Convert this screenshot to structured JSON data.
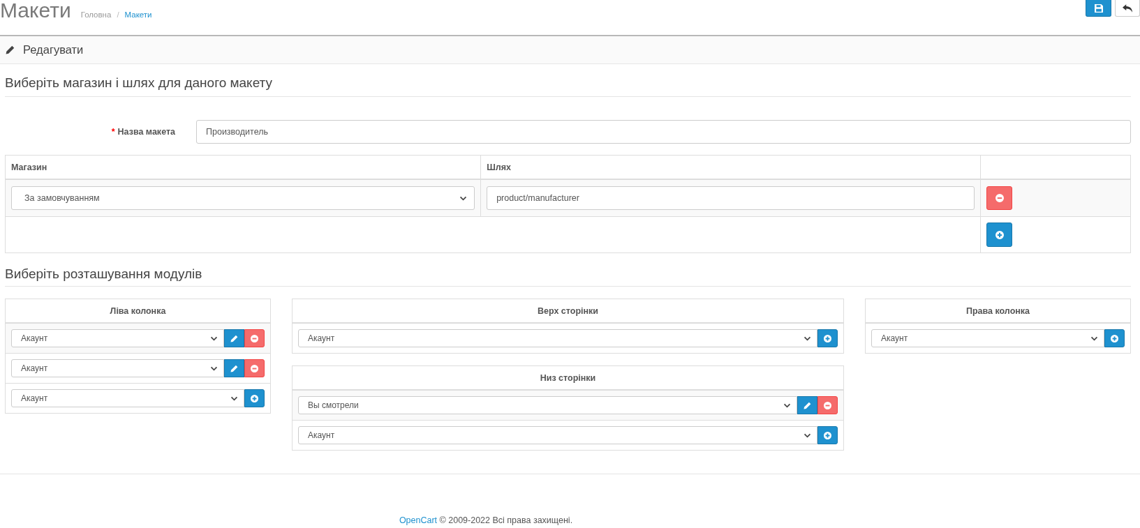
{
  "page_header": {
    "title": "Макети",
    "breadcrumb": {
      "separator": "/",
      "items": [
        {
          "label": "Головна",
          "current": false
        },
        {
          "label": "Макети",
          "current": true
        }
      ]
    },
    "actions": [
      {
        "kind": "save"
      },
      {
        "kind": "back"
      }
    ]
  },
  "panel": {
    "heading": "Редагувати"
  },
  "store_route_section": {
    "legend": "Виберіть магазин і шлях для даного макету",
    "name_field": {
      "label": "Назва макета",
      "required_mark": "*",
      "value": "Производитель"
    },
    "table": {
      "columns": [
        "Магазин",
        "Шлях"
      ],
      "rows": [
        {
          "store": "За замовчуванням",
          "route": "product/manufacturer"
        }
      ]
    }
  },
  "module_section": {
    "legend": "Виберіть розташування модулів",
    "columns": [
      {
        "positions": [
          {
            "title": "Ліва колонка",
            "modules": [
              "Акаунт",
              "Акаунт"
            ],
            "new_module": "Акаунт"
          }
        ]
      },
      {
        "positions": [
          {
            "title": "Верх сторінки",
            "new_module": "Акаунт"
          },
          {
            "title": "Низ сторінки",
            "modules": [
              "Вы смотрели"
            ],
            "new_module": "Акаунт"
          }
        ]
      },
      {
        "positions": [
          {
            "title": "Права колонка",
            "new_module": "Акаунт"
          }
        ]
      }
    ]
  },
  "footer": {
    "link": "OpenCart",
    "text": "© 2009-2022 Всі права захищені."
  }
}
